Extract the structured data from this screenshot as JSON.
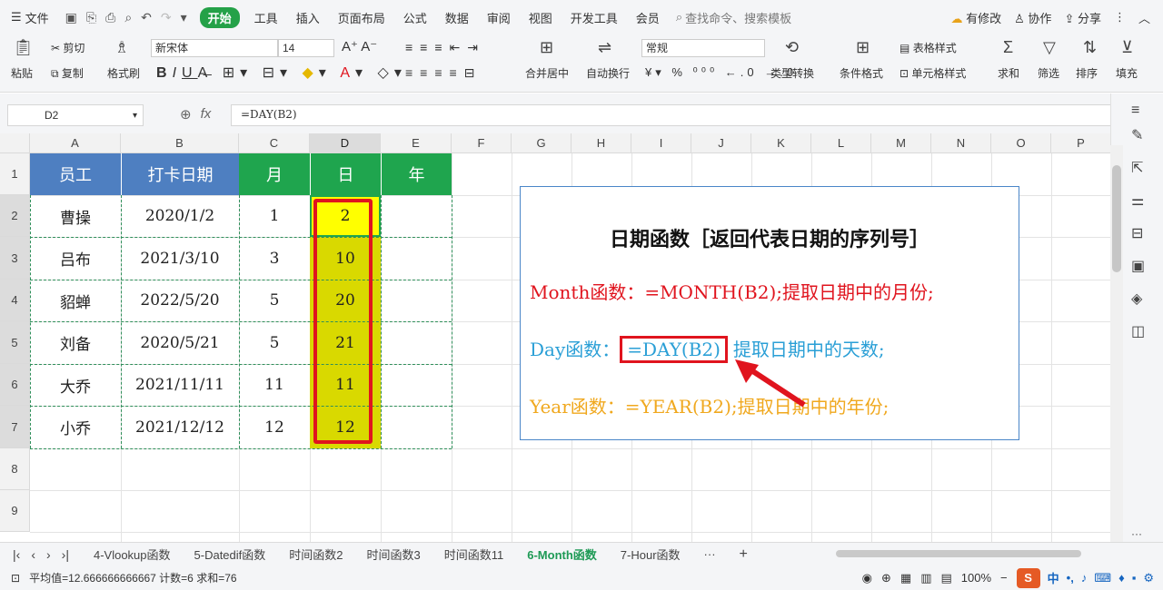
{
  "menubar": {
    "file_label": "文件",
    "tabs": [
      "开始",
      "工具",
      "插入",
      "页面布局",
      "公式",
      "数据",
      "审阅",
      "视图",
      "开发工具",
      "会员"
    ],
    "search_placeholder": "查找命令、搜索模板",
    "right": {
      "modify": "有修改",
      "collab": "协作",
      "share": "分享"
    }
  },
  "ribbon": {
    "paste": "粘贴",
    "cut": "剪切",
    "copy": "复制",
    "format_painter": "格式刷",
    "font_name": "新宋体",
    "font_size": "14",
    "merge_center": "合并居中",
    "wrap": "自动换行",
    "number_format": "常规",
    "type_convert": "类型转换",
    "conditional_format": "条件格式",
    "table_style": "表格样式",
    "cell_style": "单元格样式",
    "sum": "求和",
    "filter": "筛选",
    "sort": "排序",
    "fill": "填充"
  },
  "formula_bar": {
    "name_box": "D2",
    "formula": "=DAY(B2)"
  },
  "columns": [
    "A",
    "B",
    "C",
    "D",
    "E",
    "F",
    "G",
    "H",
    "I",
    "J",
    "K",
    "L",
    "M",
    "N",
    "O",
    "P"
  ],
  "rows": [
    "1",
    "2",
    "3",
    "4",
    "5",
    "6",
    "7",
    "8",
    "9"
  ],
  "table": {
    "headers": [
      "员工",
      "打卡日期",
      "月",
      "日",
      "年"
    ],
    "rows": [
      [
        "曹操",
        "2020/1/2",
        "1",
        "2",
        ""
      ],
      [
        "吕布",
        "2021/3/10",
        "3",
        "10",
        ""
      ],
      [
        "貂蝉",
        "2022/5/20",
        "5",
        "20",
        ""
      ],
      [
        "刘备",
        "2020/5/21",
        "5",
        "21",
        ""
      ],
      [
        "大乔",
        "2021/11/11",
        "11",
        "11",
        ""
      ],
      [
        "小乔",
        "2021/12/12",
        "12",
        "12",
        ""
      ]
    ]
  },
  "infobox": {
    "title": "日期函数［返回代表日期的序列号］",
    "month": "Month函数：=MONTH(B2);提取日期中的月份;",
    "day_prefix": "Day函数：",
    "day_formula": "=DAY(B2)",
    "day_suffix": "提取日期中的天数;",
    "year": "Year函数：=YEAR(B2);提取日期中的年份;"
  },
  "sheets": [
    "4-Vlookup函数",
    "5-Datedif函数",
    "时间函数2",
    "时间函数3",
    "时间函数11",
    "6-Month函数",
    "7-Hour函数"
  ],
  "active_sheet": "6-Month函数",
  "status": {
    "summary": "平均值=12.666666666667  计数=6  求和=76",
    "zoom": "100%"
  },
  "colors": {
    "header_blue": "#4e7fc1",
    "header_green": "#1fa54e",
    "highlight_yellow": "#d9d900",
    "selected_yellow": "#ffff00",
    "accent_red": "#e0141e",
    "month_red": "#e0141e",
    "day_blue": "#2a9fd6",
    "year_gold": "#f0a81e"
  }
}
